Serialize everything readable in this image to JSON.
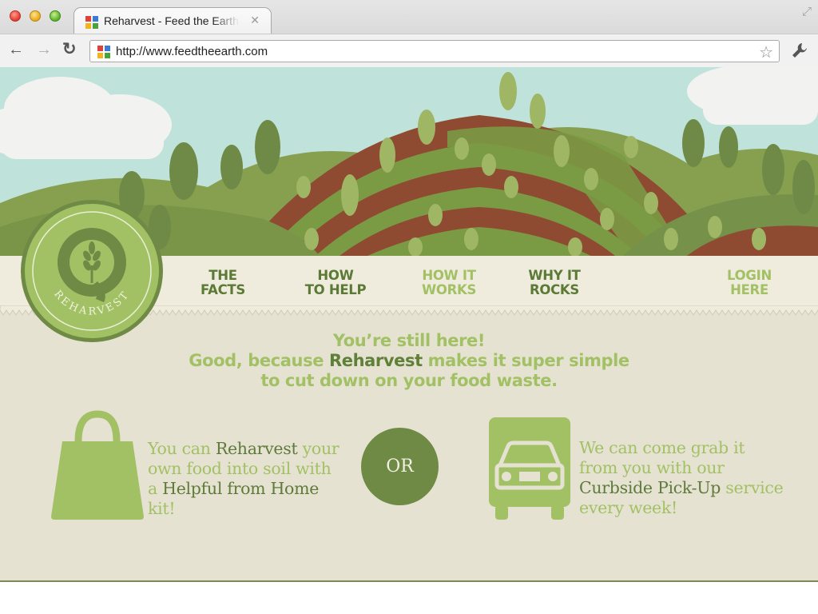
{
  "browser": {
    "tab_title": "Reharvest - Feed the Earth",
    "tab_close": "✕",
    "url": "http://www.feedtheearth.com",
    "icons": {
      "back": "back-arrow-icon",
      "forward": "forward-arrow-icon",
      "reload": "reload-icon",
      "bookmark": "star-icon",
      "settings": "wrench-icon",
      "resize": "fullscreen-icon"
    }
  },
  "site": {
    "logo_text": "REHARVEST",
    "nav": [
      {
        "line1": "THE",
        "line2": "FACTS"
      },
      {
        "line1": "HOW",
        "line2": "TO HELP"
      },
      {
        "line1": "HOW IT",
        "line2": "WORKS"
      },
      {
        "line1": "WHY IT",
        "line2": "ROCKS"
      },
      {
        "line1": "LOGIN",
        "line2": "HERE"
      }
    ],
    "headline": {
      "line1": "You’re still here!",
      "line2_pre": "Good, because ",
      "line2_brand": "Reharvest",
      "line2_post": " makes it super simple",
      "line3": "to cut down on your food waste."
    },
    "or_label": "OR",
    "left_copy": {
      "p1": "You can ",
      "b1": "Reharvest",
      "p2": " your own food into soil with a ",
      "b2": "Helpful from Home",
      "p3": " kit!"
    },
    "right_copy": {
      "p1": "We can come grab it from you with our ",
      "b1": "Curbside Pick-Up",
      "p2": " service every week!"
    }
  },
  "colors": {
    "light_green": "#a2c165",
    "dark_green": "#5b7a36",
    "olive": "#6e8a45",
    "page_bg": "#e6e2d2",
    "nav_bg": "#f0ecdd",
    "sky": "#bfe3da",
    "soil": "#8f4a32"
  }
}
